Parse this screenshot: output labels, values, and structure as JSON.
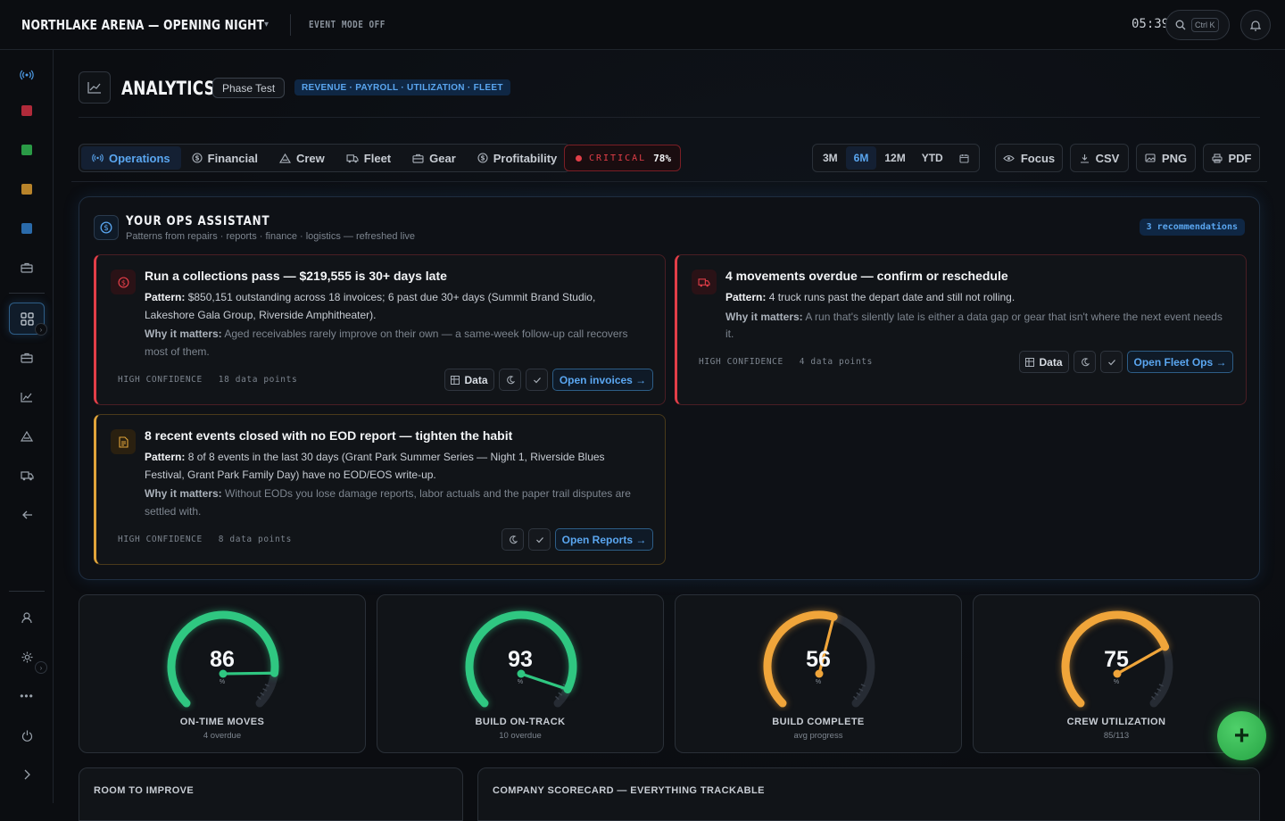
{
  "header": {
    "brand": "NORTHLAKE ARENA — OPENING NIGHT",
    "brand_caret": "▾",
    "event_mode": "EVENT MODE OFF",
    "clock": "05:39",
    "search_shortcut": "Ctrl K"
  },
  "sidebar": {
    "items": [
      "live-signal",
      "red-status",
      "green-status",
      "amber-status",
      "blue-status",
      "briefcase",
      "dashboard",
      "briefcase-2",
      "analytics",
      "tent",
      "truck",
      "back"
    ],
    "bottom_items": [
      "user",
      "settings",
      "more",
      "power",
      "expand"
    ]
  },
  "page": {
    "title": "ANALYTICS",
    "phase": "Phase Test",
    "scope": "REVENUE · PAYROLL · UTILIZATION · FLEET"
  },
  "tabs": [
    {
      "label": "Operations",
      "icon": "signal-icon"
    },
    {
      "label": "Financial",
      "icon": "dollar-icon"
    },
    {
      "label": "Crew",
      "icon": "tent-icon"
    },
    {
      "label": "Fleet",
      "icon": "truck-icon"
    },
    {
      "label": "Gear",
      "icon": "case-icon"
    },
    {
      "label": "Profitability",
      "icon": "dollar-icon"
    }
  ],
  "critical": {
    "label": "CRITICAL",
    "value": "78%"
  },
  "ranges": [
    "3M",
    "6M",
    "12M",
    "YTD"
  ],
  "range_selected": "6M",
  "tools": {
    "focus": "Focus",
    "csv": "CSV",
    "png": "PNG",
    "pdf": "PDF"
  },
  "assistant": {
    "title": "YOUR OPS ASSISTANT",
    "subtitle": "Patterns from repairs · reports · finance · logistics — refreshed live",
    "reco_count": "3 recommendations",
    "cards": [
      {
        "title": "Run a collections pass — $219,555 is 30+ days late",
        "pattern_label": "Pattern:",
        "pattern": "$850,151 outstanding across 18 invoices; 6 past due 30+ days (Summit Brand Studio, Lakeshore Gala Group, Riverside Amphitheater).",
        "why_label": "Why it matters:",
        "why": "Aged receivables rarely improve on their own — a same-week follow-up call recovers most of them.",
        "confidence": "HIGH CONFIDENCE",
        "points": "18 data points",
        "data_btn": "Data",
        "action": "Open invoices →"
      },
      {
        "title": "4 movements overdue — confirm or reschedule",
        "pattern_label": "Pattern:",
        "pattern": "4 truck runs past the depart date and still not rolling.",
        "why_label": "Why it matters:",
        "why": "A run that's silently late is either a data gap or gear that isn't where the next event needs it.",
        "confidence": "HIGH CONFIDENCE",
        "points": "4 data points",
        "data_btn": "Data",
        "action": "Open Fleet Ops →"
      },
      {
        "title": "8 recent events closed with no EOD report — tighten the habit",
        "pattern_label": "Pattern:",
        "pattern": "8 of 8 events in the last 30 days (Grant Park Summer Series — Night 1, Riverside Blues Festival, Grant Park Family Day) have no EOD/EOS write-up.",
        "why_label": "Why it matters:",
        "why": "Without EODs you lose damage reports, labor actuals and the paper trail disputes are settled with.",
        "confidence": "HIGH CONFIDENCE",
        "points": "8 data points",
        "action": "Open Reports →"
      }
    ]
  },
  "gauges": [
    {
      "value": 86,
      "unit": "%",
      "label": "ON-TIME MOVES",
      "sub": "4 overdue",
      "color": "#2fc781"
    },
    {
      "value": 93,
      "unit": "%",
      "label": "BUILD ON-TRACK",
      "sub": "10 overdue",
      "color": "#2fc781"
    },
    {
      "value": 56,
      "unit": "%",
      "label": "BUILD COMPLETE",
      "sub": "avg progress",
      "color": "#f0a53a"
    },
    {
      "value": 75,
      "unit": "%",
      "label": "CREW UTILIZATION",
      "sub": "85/113",
      "color": "#f0a53a"
    }
  ],
  "bottom": {
    "left_title": "ROOM TO IMPROVE",
    "right_title": "COMPANY SCORECARD — EVERYTHING TRACKABLE"
  },
  "fab_label": "+"
}
